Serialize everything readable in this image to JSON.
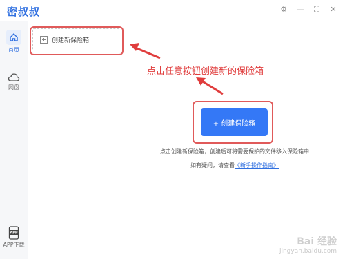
{
  "app": {
    "title": "密叔叔"
  },
  "window_controls": [
    {
      "name": "settings-icon",
      "glyph": "⚙"
    },
    {
      "name": "minimize-icon",
      "glyph": "—"
    },
    {
      "name": "maximize-icon",
      "glyph": "⛶"
    },
    {
      "name": "close-icon",
      "glyph": "✕"
    }
  ],
  "sidebar": {
    "items": [
      {
        "label": "首页",
        "icon": "home-icon",
        "active": true
      },
      {
        "label": "网盘",
        "icon": "cloud-icon",
        "active": false
      },
      {
        "label": "APP下载",
        "icon": "app-download-icon",
        "active": false
      }
    ]
  },
  "list_pane": {
    "create_item_label": "创建新保险箱"
  },
  "annotation": {
    "text": "点击任意按钮创建新的保险箱"
  },
  "main": {
    "primary_button": "+ 创建保险箱",
    "description_line1": "点击创建新保险箱，创建后可将需要保护的文件移入保险箱中",
    "description_line2_prefix": "如有疑问，请查看",
    "description_link": "《新手操作指南》"
  },
  "watermark": {
    "line1": "Bai 经验",
    "line2": "jingyan.baidu.com"
  },
  "colors": {
    "accent": "#3478f6",
    "annotation_red": "#e03d3d"
  }
}
